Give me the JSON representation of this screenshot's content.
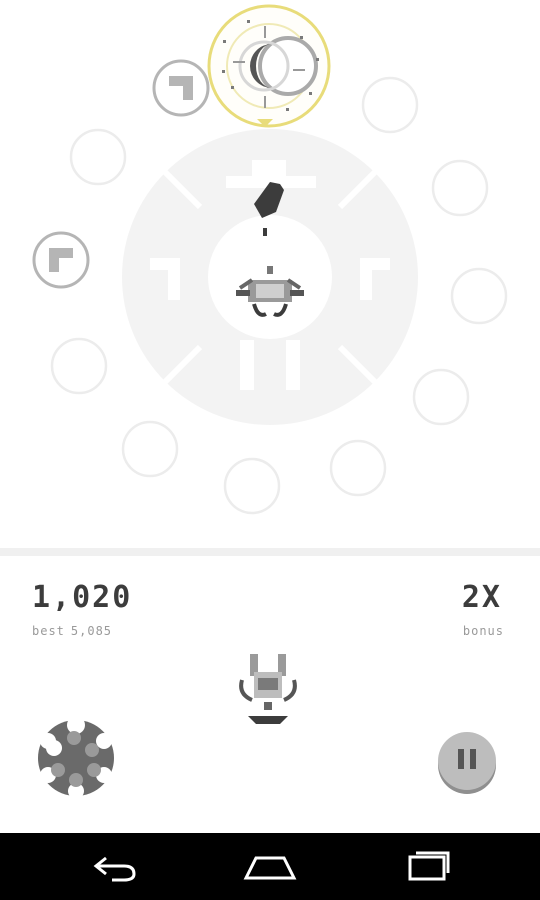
{
  "hud": {
    "score": "1,020",
    "best_label": "best",
    "best_value": "5,085",
    "multiplier": "2X",
    "bonus_label": "bonus"
  },
  "ammo": {
    "total_chambers": 7,
    "loaded_chambers": 1
  },
  "icons": {
    "pause": "pause-icon",
    "back": "back-icon",
    "home": "home-icon",
    "recents": "recent-apps-icon",
    "ammo": "revolver-cylinder-icon"
  },
  "colors": {
    "highlight_ring": "#e8dc7a",
    "dark_gray": "#3c3c3c",
    "mid_gray": "#6a6a6a",
    "light_gray": "#9a9a9a",
    "arena": "#f3f3f3",
    "slot_ring": "#ececec",
    "nav_bar": "#000000"
  }
}
